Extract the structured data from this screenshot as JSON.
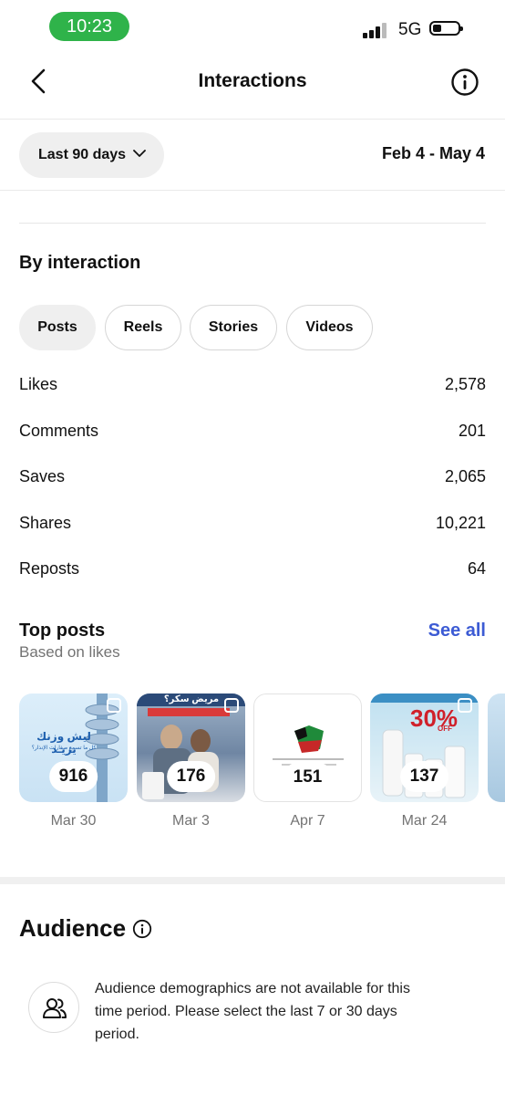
{
  "status_bar": {
    "time": "10:23",
    "network": "5G"
  },
  "header": {
    "title": "Interactions"
  },
  "range": {
    "selected": "Last 90 days",
    "dates": "Feb 4 - May 4"
  },
  "by_interaction": {
    "title": "By interaction",
    "tabs": [
      {
        "label": "Posts",
        "active": true
      },
      {
        "label": "Reels",
        "active": false
      },
      {
        "label": "Stories",
        "active": false
      },
      {
        "label": "Videos",
        "active": false
      }
    ],
    "metrics": [
      {
        "label": "Likes",
        "value": "2,578"
      },
      {
        "label": "Comments",
        "value": "201"
      },
      {
        "label": "Saves",
        "value": "2,065"
      },
      {
        "label": "Shares",
        "value": "10,221"
      },
      {
        "label": "Reposts",
        "value": "64"
      }
    ]
  },
  "top_posts": {
    "title": "Top posts",
    "subtitle": "Based on likes",
    "see_all": "See all",
    "posts": [
      {
        "count": "916",
        "date": "Mar 30",
        "overlay_text": "ليش وزنك يزيـد",
        "overlay_sub": "كل ما تسمع صفارات الإنذار؟"
      },
      {
        "count": "176",
        "date": "Mar 3",
        "overlay_text": "مريض سكر؟"
      },
      {
        "count": "151",
        "date": "Apr 7"
      },
      {
        "count": "137",
        "date": "Mar 24",
        "overlay_text": "30%",
        "overlay_sub": "OFF"
      }
    ]
  },
  "audience": {
    "title": "Audience",
    "message": "Audience demographics are not available for this time period. Please select the last 7 or 30 days period."
  },
  "colors": {
    "accent": "#3c5bd4",
    "time_pill": "#2fb34a"
  }
}
